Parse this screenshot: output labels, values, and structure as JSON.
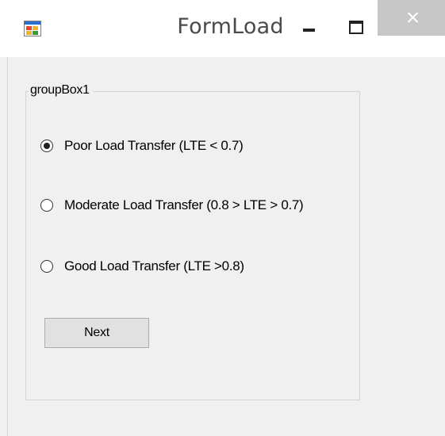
{
  "window": {
    "title": "FormLoad",
    "icon": "winforms-app-icon"
  },
  "title_buttons": {
    "minimize_icon": "minimize-icon",
    "maximize_icon": "maximize-icon",
    "close_icon": "close-icon"
  },
  "group_box": {
    "label": "groupBox1",
    "options": [
      {
        "label": "Poor Load Transfer (LTE < 0.7)",
        "checked": true
      },
      {
        "label": "Moderate Load Transfer (0.8 > LTE > 0.7)",
        "checked": false
      },
      {
        "label": "Good Load Transfer (LTE >0.8)",
        "checked": false
      }
    ],
    "next_label": "Next"
  },
  "colors": {
    "form_background": "#f0f0f0",
    "titlebar_background": "#ffffff",
    "close_button_background": "#c7c7c7"
  }
}
